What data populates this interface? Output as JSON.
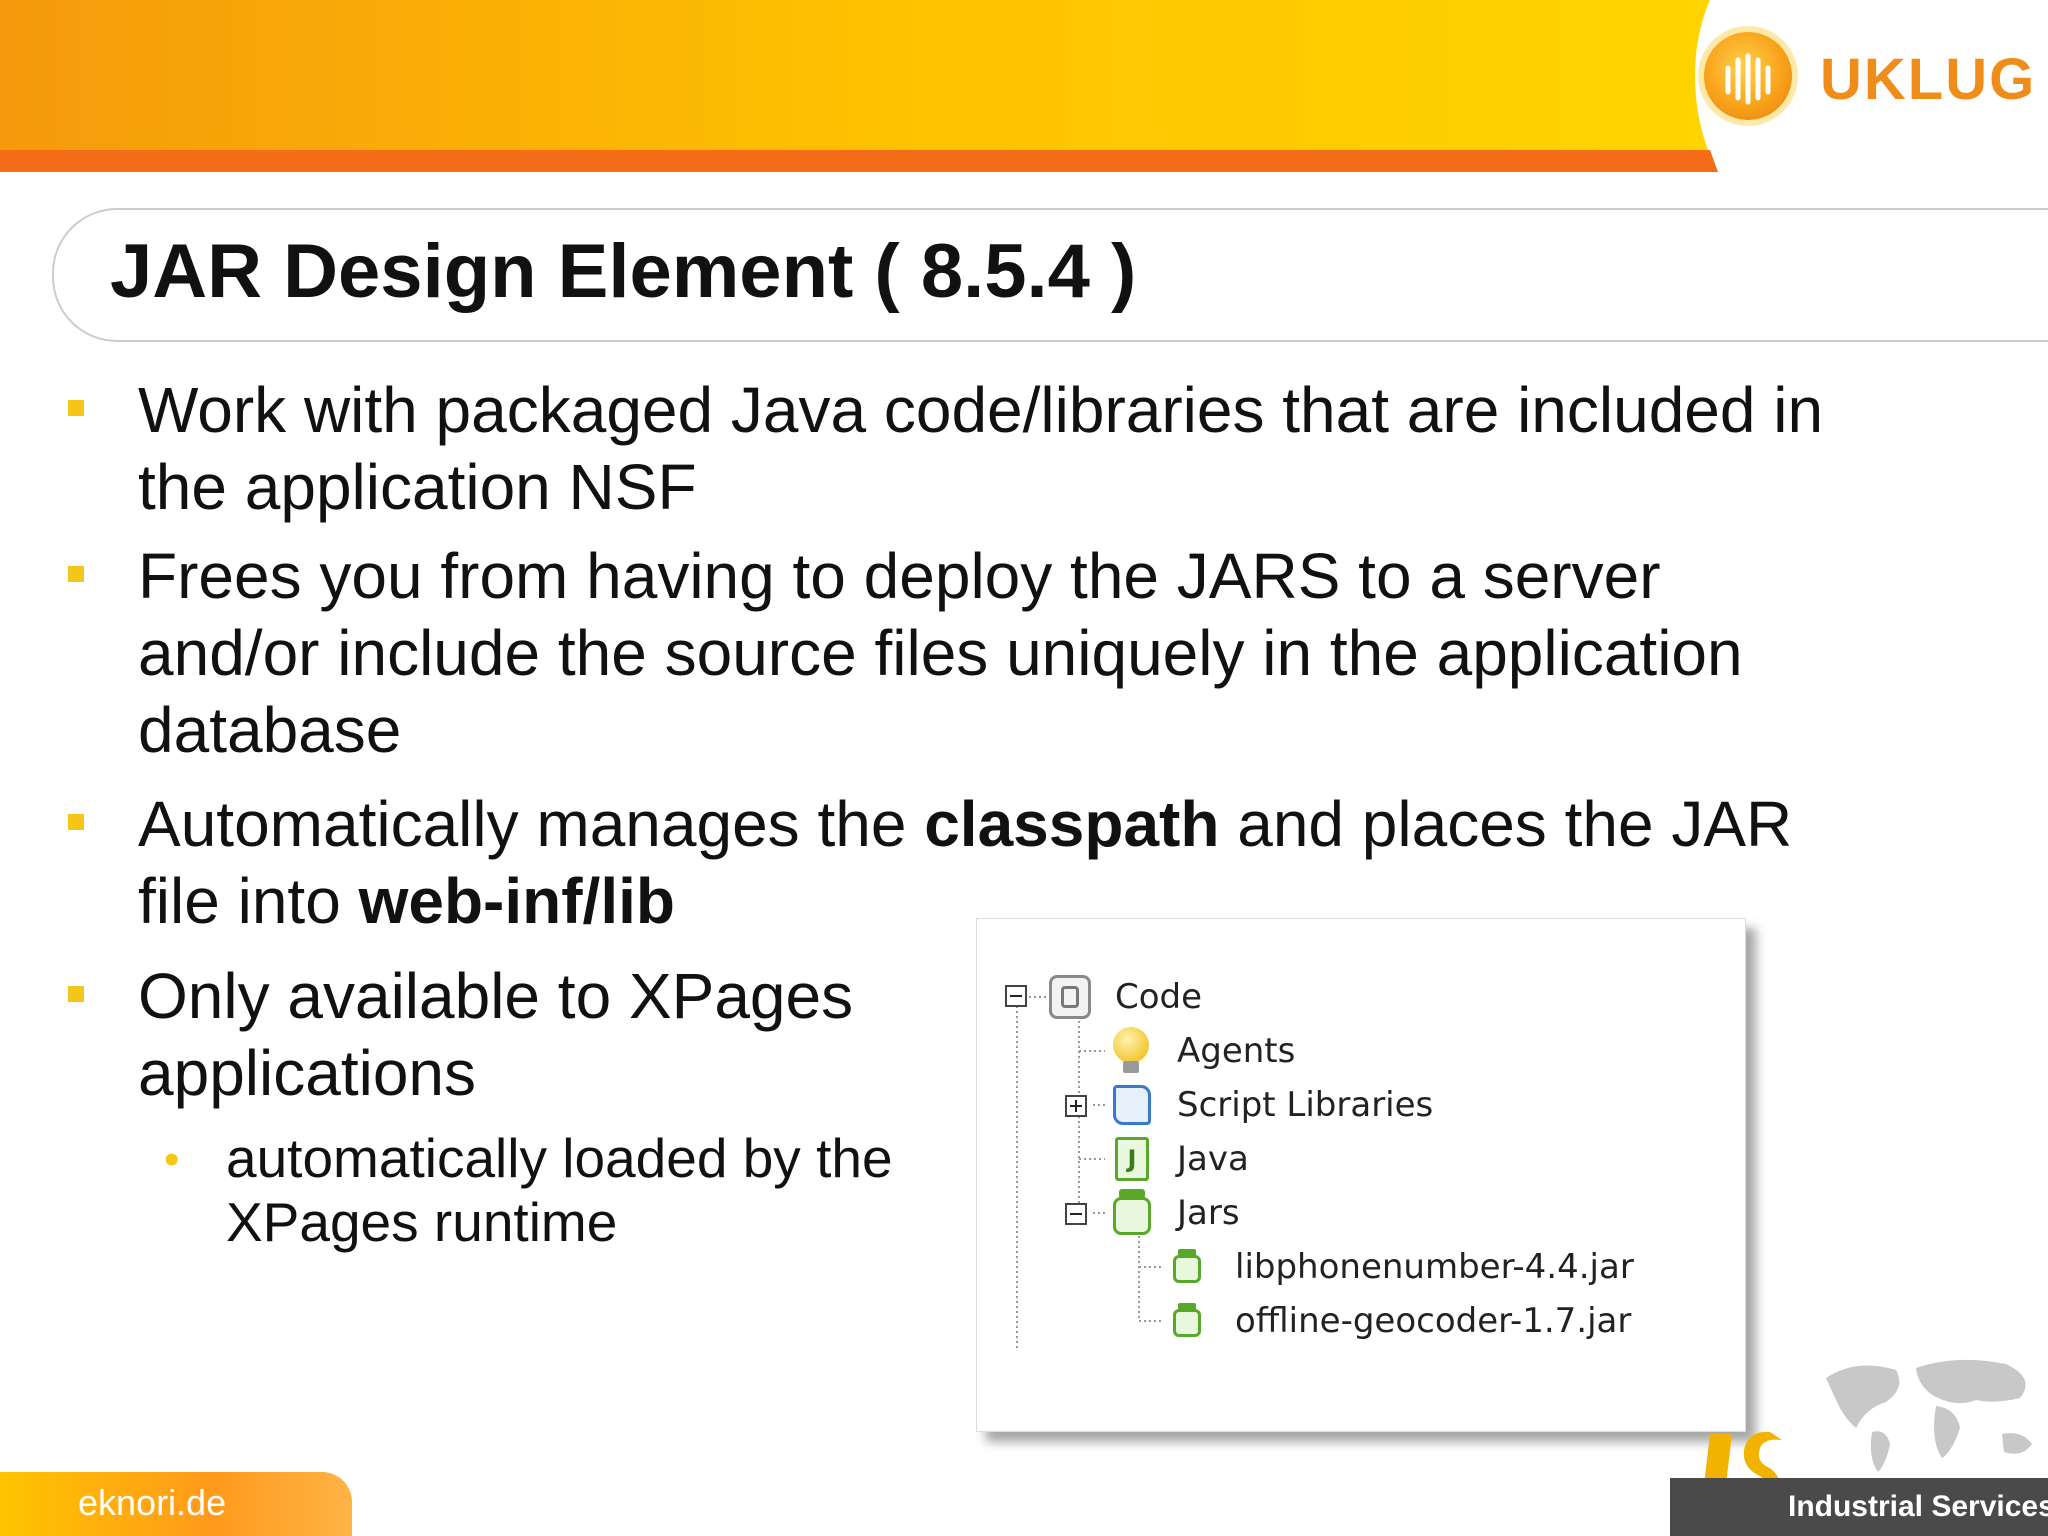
{
  "header": {
    "logo_text": "UKLUG",
    "gradient": [
      "#f59a0c",
      "#ffd400"
    ],
    "accent": "#f46e1a"
  },
  "title": "JAR Design Element ( 8.5.4 )",
  "bullets": [
    {
      "lines": [
        "Work with packaged Java code/libraries that are included in",
        "the application NSF"
      ]
    },
    {
      "lines": [
        "Frees you from having to deploy the JARS to a server",
        "and/or include the source files uniquely in the application",
        "database"
      ]
    },
    {
      "line1_prefix": "Automatically manages the ",
      "line1_bold": "classpath",
      "line1_suffix": " and places the JAR",
      "line2_prefix": "file into ",
      "line2_bold": "web-inf/lib"
    },
    {
      "lines": [
        "Only available to XPages",
        "applications"
      ]
    }
  ],
  "sub_bullet": {
    "marker": "•",
    "text": " automatically loaded by the XPages runtime"
  },
  "tree": {
    "root": "Code",
    "items": [
      "Agents",
      "Script Libraries",
      "Java",
      "Jars"
    ],
    "jars": [
      "libphonenumber-4.4.jar",
      "offline-geocoder-1.7.jar"
    ],
    "icons": {
      "root": "code-icon",
      "agents": "lightbulb-icon",
      "script_libraries": "scroll-icon",
      "java": "java-file-icon",
      "jars": "jar-icon"
    }
  },
  "footer": {
    "site": "eknori.de",
    "brand": "Industrial Services"
  }
}
